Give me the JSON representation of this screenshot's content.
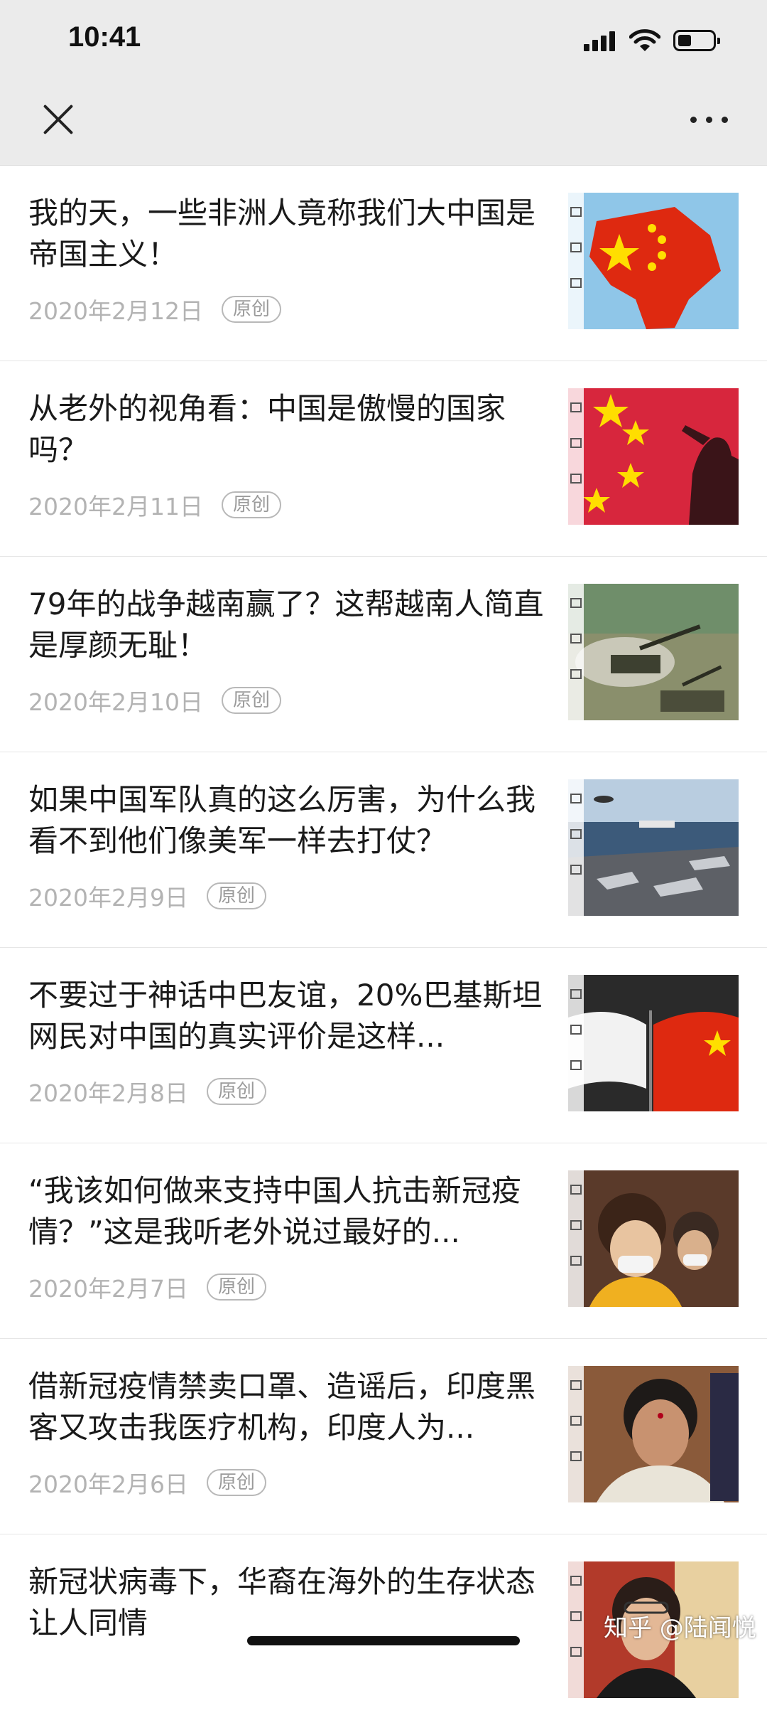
{
  "status_bar": {
    "time": "10:41"
  },
  "nav": {
    "close_icon": "close-icon",
    "more_icon": "more-icon"
  },
  "articles": [
    {
      "title": "我的天，一些非洲人竟称我们大中国是帝国主义！",
      "date": "2020年2月12日",
      "tag": "原创",
      "thumb": "africa-flag-map"
    },
    {
      "title": "从老外的视角看：中国是傲慢的国家吗？",
      "date": "2020年2月11日",
      "tag": "原创",
      "thumb": "flag-salute"
    },
    {
      "title": "79年的战争越南赢了？这帮越南人简直是厚颜无耻！",
      "date": "2020年2月10日",
      "tag": "原创",
      "thumb": "artillery"
    },
    {
      "title": "如果中国军队真的这么厉害，为什么我看不到他们像美军一样去打仗？",
      "date": "2020年2月9日",
      "tag": "原创",
      "thumb": "carrier"
    },
    {
      "title": "不要过于神话中巴友谊，20%巴基斯坦网民对中国的真实评价是这样...",
      "date": "2020年2月8日",
      "tag": "原创",
      "thumb": "two-flags"
    },
    {
      "title": "“我该如何做来支持中国人抗击新冠疫情？”这是我听老外说过最好的...",
      "date": "2020年2月7日",
      "tag": "原创",
      "thumb": "masked-people"
    },
    {
      "title": "借新冠疫情禁卖口罩、造谣后，印度黑客又攻击我医疗机构，印度人为...",
      "date": "2020年2月6日",
      "tag": "原创",
      "thumb": "woman-speaking"
    },
    {
      "title": "新冠状病毒下，华裔在海外的生存状态让人同情",
      "date": "",
      "tag": "",
      "thumb": "woman-mask"
    }
  ],
  "watermark": "知乎 @陆闻悦",
  "colors": {
    "topbar": "#ebebeb",
    "date": "#b3b3b3",
    "flag_red": "#de2910",
    "flag_yellow": "#ffde00"
  }
}
